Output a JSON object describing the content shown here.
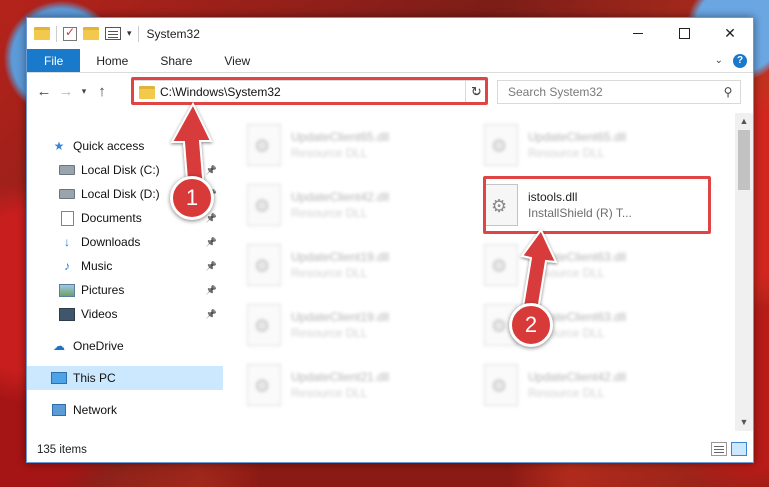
{
  "window": {
    "title": "System32",
    "colors": {
      "accent": "#1979ca",
      "highlight": "#e04545",
      "selection": "#cce8ff"
    }
  },
  "ribbon": {
    "tabs": [
      "File",
      "Home",
      "Share",
      "View"
    ],
    "help_label": "?"
  },
  "address": {
    "path": "C:\\Windows\\System32",
    "search_placeholder": "Search System32"
  },
  "nav": {
    "items": [
      {
        "label": "Quick access",
        "icon": "star-icon"
      },
      {
        "label": "Local Disk (C:)",
        "icon": "disk-icon",
        "pinned": true
      },
      {
        "label": "Local Disk (D:)",
        "icon": "disk-icon",
        "pinned": true
      },
      {
        "label": "Documents",
        "icon": "docs-icon",
        "pinned": true
      },
      {
        "label": "Downloads",
        "icon": "down-icon",
        "pinned": true
      },
      {
        "label": "Music",
        "icon": "music-icon",
        "pinned": true
      },
      {
        "label": "Pictures",
        "icon": "pics-icon",
        "pinned": true
      },
      {
        "label": "Videos",
        "icon": "videos-icon",
        "pinned": true
      },
      {
        "label": "OneDrive",
        "icon": "cloud-icon"
      },
      {
        "label": "This PC",
        "icon": "pc-icon",
        "selected": true
      },
      {
        "label": "Network",
        "icon": "net-icon"
      }
    ]
  },
  "files": {
    "left": [
      {
        "name": "UpdateClient65.dll",
        "desc": "Resource DLL"
      },
      {
        "name": "UpdateClient42.dll",
        "desc": "Resource DLL"
      },
      {
        "name": "UpdateClient19.dll",
        "desc": "Resource DLL"
      },
      {
        "name": "UpdateClient19.dll",
        "desc": "Resource DLL"
      },
      {
        "name": "UpdateClient21.dll",
        "desc": "Resource DLL"
      }
    ],
    "right": [
      {
        "name": "UpdateClient65.dll",
        "desc": "Resource DLL"
      },
      {
        "name": "istools.dll",
        "desc": "InstallShield (R) T...",
        "focus": true
      },
      {
        "name": "UpdateClient63.dll",
        "desc": "Resource DLL"
      },
      {
        "name": "UpdateClient63.dll",
        "desc": "Resource DLL"
      },
      {
        "name": "UpdateClient42.dll",
        "desc": "Resource DLL"
      }
    ]
  },
  "status": {
    "item_count": "135 items"
  },
  "callouts": {
    "step1": "1",
    "step2": "2"
  }
}
